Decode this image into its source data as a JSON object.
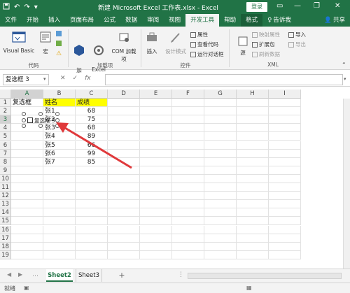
{
  "titlebar": {
    "qat_icons": [
      "save-icon",
      "undo-icon",
      "redo-icon",
      "customize-icon"
    ],
    "doc_title": "新建 Microsoft Excel 工作表.xlsx  -  Excel",
    "login_label": "登录",
    "window_controls": [
      "ribbon-display-icon",
      "minimize-icon",
      "restore-icon",
      "close-icon"
    ]
  },
  "tabs": {
    "items": [
      "文件",
      "开始",
      "插入",
      "页面布局",
      "公式",
      "数据",
      "审阅",
      "视图",
      "开发工具",
      "帮助",
      "格式"
    ],
    "active": "开发工具",
    "tell_me": "告诉我",
    "share": "共享"
  },
  "ribbon": {
    "code": {
      "visual_basic": "Visual Basic",
      "macro": "宏",
      "group": "代码"
    },
    "addins": {
      "addin": "加\n载项",
      "excel_addin": "Excel\n加载项",
      "com_addin": "COM 加载项",
      "group": "加载项"
    },
    "controls": {
      "insert": "插入",
      "design_mode": "设计模式",
      "properties": "属性",
      "view_code": "查看代码",
      "run_dialog": "运行对话框",
      "group": "控件"
    },
    "xml": {
      "source": "源",
      "map_properties": "映射属性",
      "expansion_pack": "扩展包",
      "refresh_data": "刷新数据",
      "import": "导入",
      "export": "导出",
      "group": "XML"
    }
  },
  "formula_bar": {
    "name_box": "复选框 3",
    "cancel": "✕",
    "enter": "✓",
    "fx": "fx",
    "formula": ""
  },
  "sheet": {
    "columns": [
      "A",
      "B",
      "C",
      "D",
      "E",
      "F",
      "G",
      "H",
      "I"
    ],
    "rows": [
      "1",
      "2",
      "3",
      "4",
      "5",
      "6",
      "7",
      "8",
      "9",
      "10",
      "11",
      "12",
      "13",
      "14",
      "15",
      "16",
      "17",
      "18",
      "19"
    ],
    "a1": "复选框",
    "b1": "姓名",
    "c1": "成绩",
    "names": [
      "张1",
      "张2",
      "张3",
      "张4",
      "张5",
      "张6",
      "张7"
    ],
    "scores": [
      "68",
      "75",
      "68",
      "89",
      "66",
      "99",
      "85"
    ],
    "checkbox_label": "复选框 3",
    "highlight_color": "#ffff00",
    "arrow_color": "#e0393b"
  },
  "sheet_tabs": {
    "items": [
      "Sheet2",
      "Sheet3"
    ],
    "active": "Sheet2",
    "add": "+"
  },
  "status": {
    "ready": "就绪"
  },
  "colors": {
    "brand": "#217346"
  }
}
